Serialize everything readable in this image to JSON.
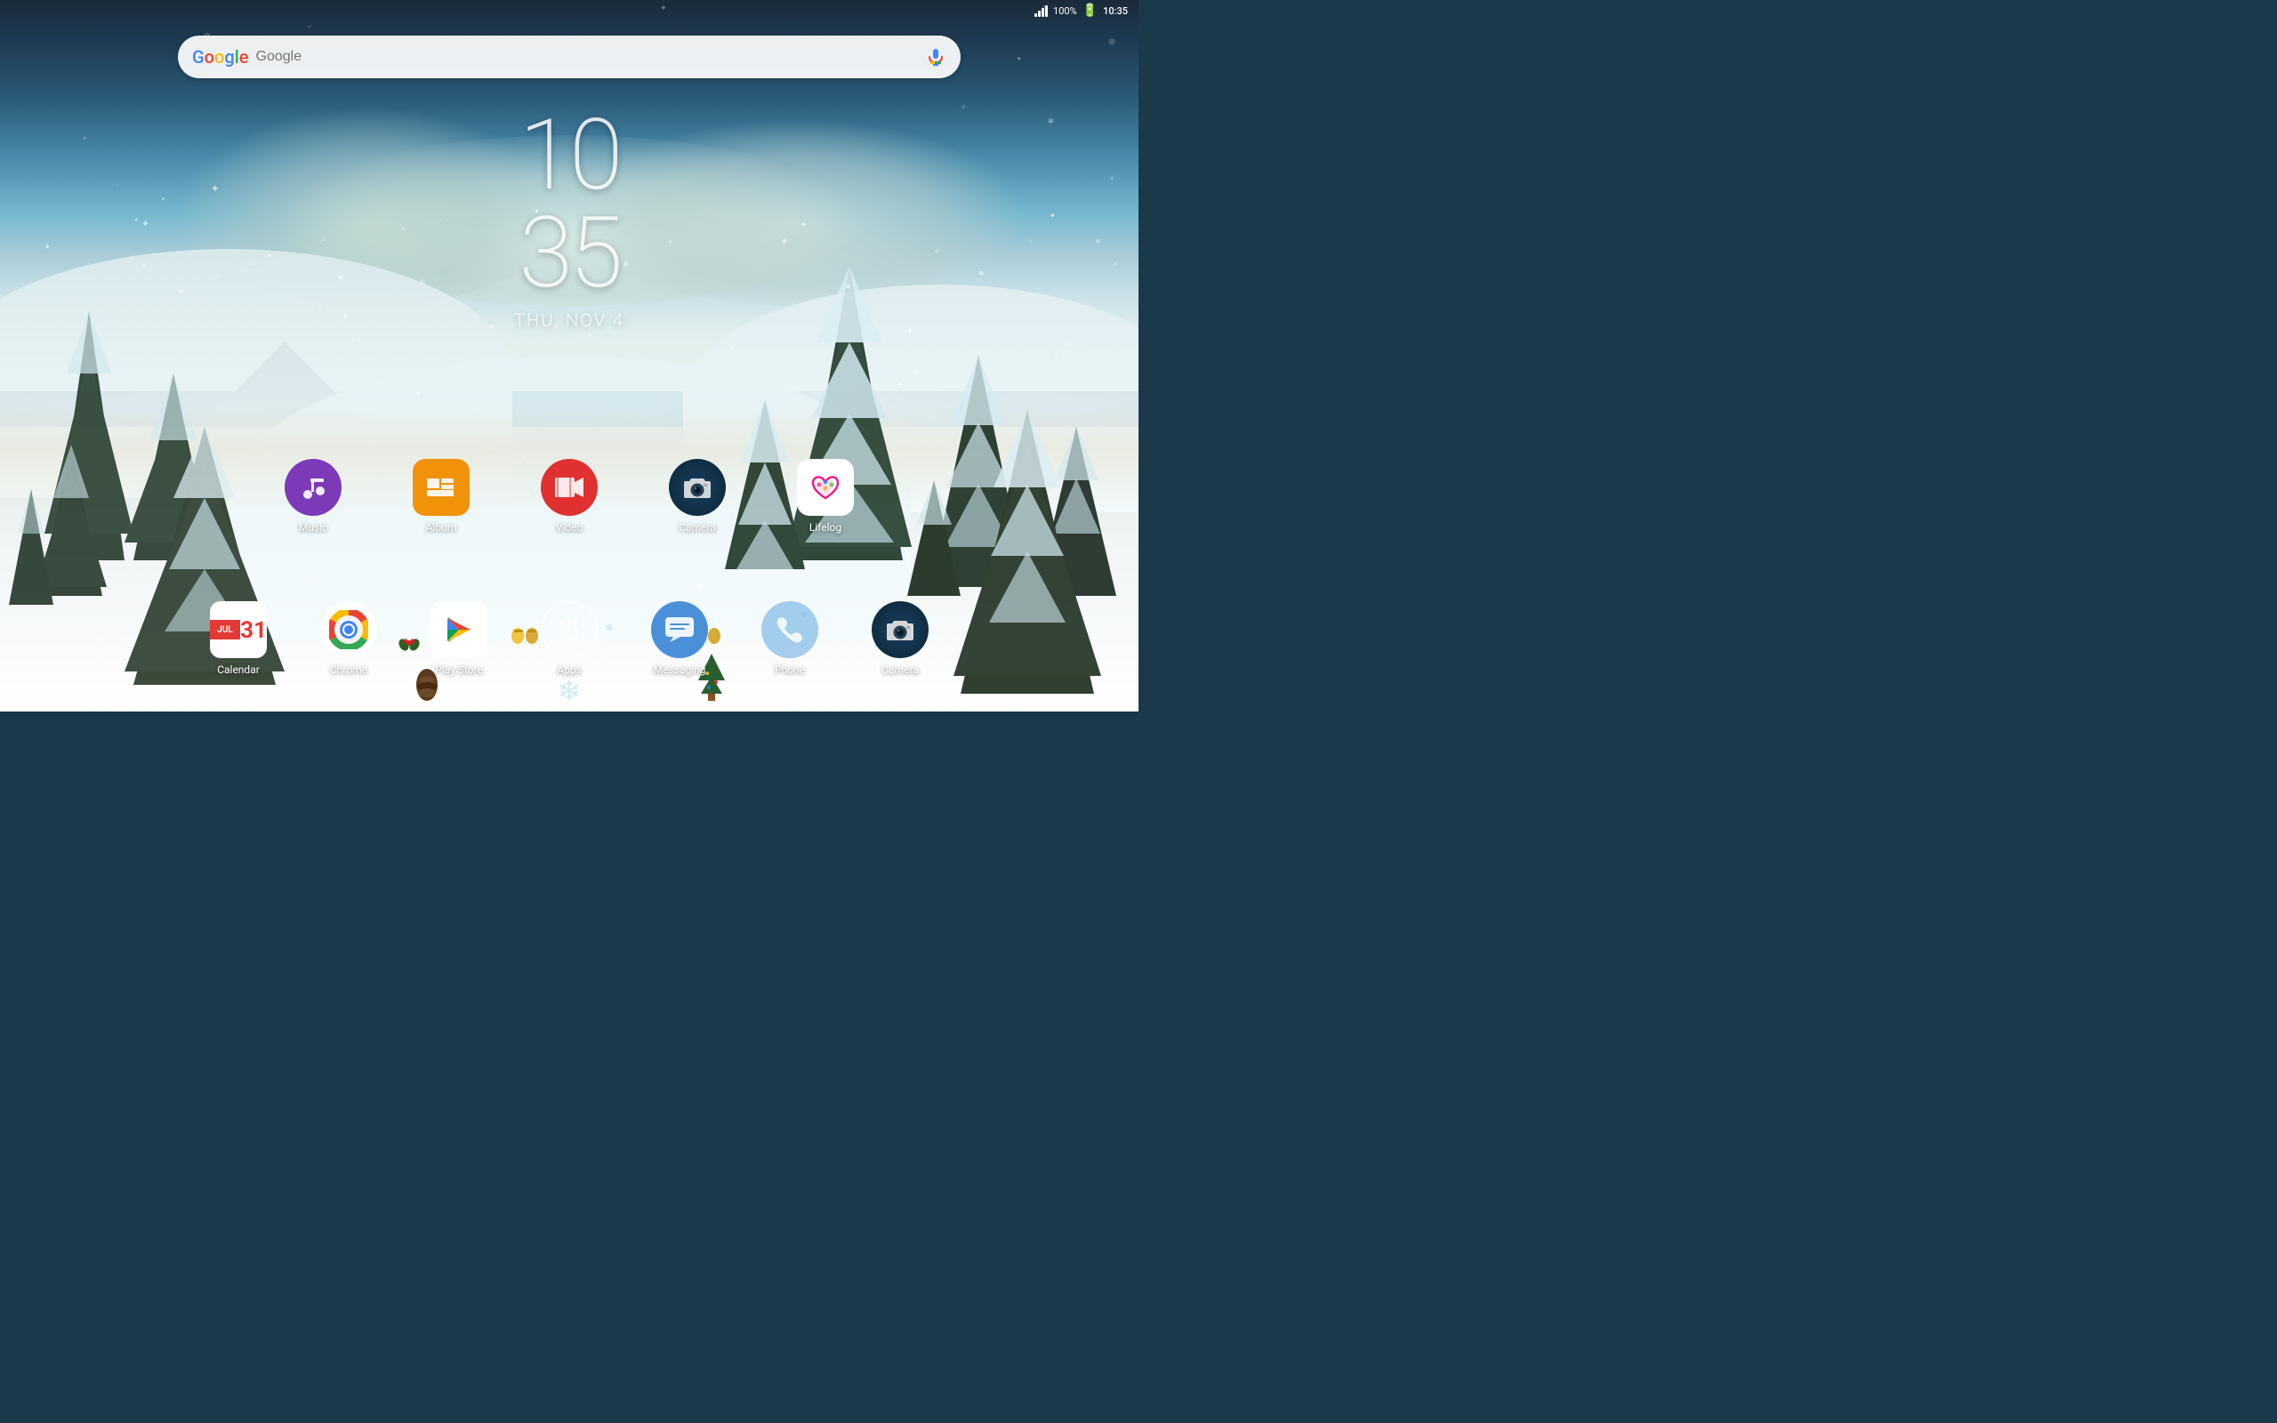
{
  "status": {
    "time": "10:35",
    "battery": "100%",
    "signal": "full"
  },
  "clock": {
    "hour": "10",
    "minute": "35",
    "date": "THU, NOV 4"
  },
  "search": {
    "placeholder": "Google"
  },
  "middle_apps": [
    {
      "id": "music",
      "label": "Music",
      "icon": "music"
    },
    {
      "id": "album",
      "label": "Album",
      "icon": "album"
    },
    {
      "id": "video",
      "label": "Video",
      "icon": "video"
    },
    {
      "id": "camera-mid",
      "label": "Camera",
      "icon": "camera"
    },
    {
      "id": "lifelog",
      "label": "Lifelog",
      "icon": "lifelog"
    }
  ],
  "dock_apps": [
    {
      "id": "calendar",
      "label": "Calendar",
      "icon": "calendar"
    },
    {
      "id": "chrome",
      "label": "Chrome",
      "icon": "chrome"
    },
    {
      "id": "playstore",
      "label": "Play Store",
      "icon": "playstore"
    },
    {
      "id": "apps",
      "label": "Apps",
      "icon": "apps"
    },
    {
      "id": "messaging",
      "label": "Messaging",
      "icon": "messaging"
    },
    {
      "id": "phone",
      "label": "Phone",
      "icon": "phone"
    },
    {
      "id": "camera-dock",
      "label": "Camera",
      "icon": "camera"
    }
  ]
}
